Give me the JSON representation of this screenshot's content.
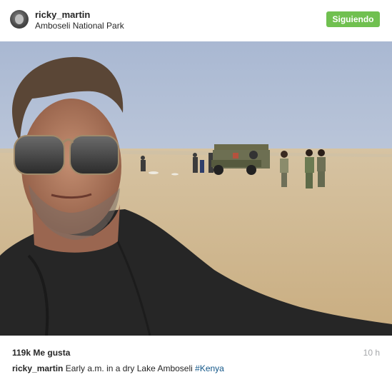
{
  "post": {
    "username": "ricky_martin",
    "location": "Amboseli National Park",
    "follow_label": "Siguiendo",
    "likes": "119k Me gusta",
    "time": "10 h",
    "caption_text": "Early a.m. in a dry Lake Amboseli",
    "hashtag": "#Kenya"
  },
  "colors": {
    "follow_button": "#70c050",
    "hashtag": "#125688",
    "time": "#a5a7aa"
  }
}
